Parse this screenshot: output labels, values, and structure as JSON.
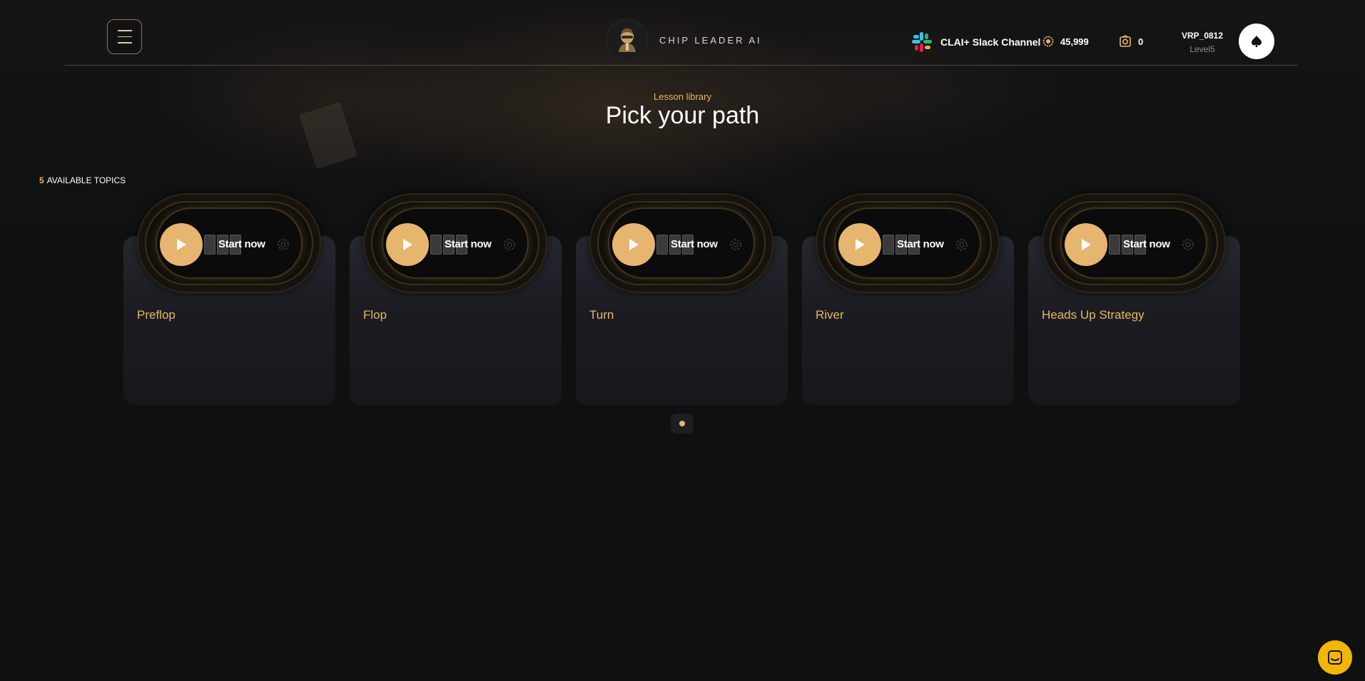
{
  "header": {
    "brand_name": "CHIP LEADER AI",
    "slack_label": "CLAI+ Slack Channel",
    "coins": "45,999",
    "rewards": "0",
    "username": "VRP_0812",
    "level": "Level5"
  },
  "hero": {
    "eyebrow": "Lesson library",
    "title": "Pick your path"
  },
  "topics": {
    "count": "5",
    "label": "AVAILABLE TOPICS",
    "cards": [
      {
        "title": "Preflop",
        "cta": "Start now"
      },
      {
        "title": "Flop",
        "cta": "Start now"
      },
      {
        "title": "Turn",
        "cta": "Start now"
      },
      {
        "title": "River",
        "cta": "Start now"
      },
      {
        "title": "Heads Up Strategy",
        "cta": "Start now"
      }
    ]
  },
  "pager": {
    "pages": 1,
    "current": 1
  },
  "colors": {
    "accent": "#e6b56f",
    "background": "#0f1111",
    "card": "#1d1e23",
    "chat": "#f2b705"
  },
  "icons": [
    "menu-icon",
    "brand-logo-icon",
    "slack-icon",
    "coin-icon",
    "rewards-icon",
    "spade-icon",
    "play-icon",
    "chip-icon",
    "chat-icon"
  ]
}
